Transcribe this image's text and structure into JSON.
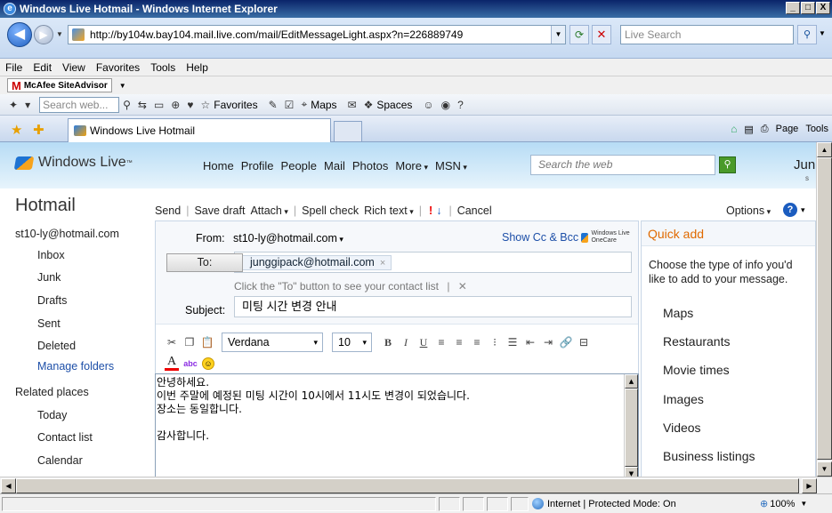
{
  "window": {
    "title": "Windows Live Hotmail - Windows Internet Explorer",
    "min": "_",
    "max": "□",
    "close": "X"
  },
  "address": {
    "url": "http://by104w.bay104.mail.live.com/mail/EditMessageLight.aspx?n=226889749",
    "search_placeholder": "Live Search"
  },
  "menu": [
    "File",
    "Edit",
    "View",
    "Favorites",
    "Tools",
    "Help"
  ],
  "mcafee": {
    "label": "McAfee SiteAdvisor"
  },
  "toolbar": {
    "search_placeholder": "Search web...",
    "favorites": "Favorites",
    "maps": "Maps",
    "spaces": "Spaces"
  },
  "tabs": {
    "active": "Windows Live Hotmail",
    "page_menu": "Page",
    "tools_menu": "Tools"
  },
  "wl": {
    "brand": "Windows Live",
    "brand_tm": "™",
    "nav": [
      "Home",
      "Profile",
      "People",
      "Mail",
      "Photos",
      "More",
      "MSN"
    ],
    "search_placeholder": "Search the web",
    "user": "Jun"
  },
  "hotmail": {
    "title": "Hotmail",
    "commands": {
      "send": "Send",
      "save_draft": "Save draft",
      "attach": "Attach",
      "spell_check": "Spell check",
      "rich_text": "Rich text",
      "cancel": "Cancel"
    },
    "options": "Options"
  },
  "leftnav": {
    "email": "st10-ly@hotmail.com",
    "folders": [
      "Inbox",
      "Junk",
      "Drafts",
      "Sent",
      "Deleted"
    ],
    "manage": "Manage folders",
    "related_title": "Related places",
    "related": [
      "Today",
      "Contact list",
      "Calendar"
    ]
  },
  "compose": {
    "from_label": "From:",
    "from_value": "st10-ly@hotmail.com",
    "show_cc": "Show Cc & Bcc",
    "onecare": "Windows Live OneCare",
    "to_button": "To:",
    "to_recipient": "junggipack@hotmail.com",
    "hint": "Click the \"To\" button to see your contact list",
    "subject_label": "Subject:",
    "subject_value": "미팅 시간 변경 안내",
    "font": "Verdana",
    "size": "10",
    "body": [
      "안녕하세요.",
      "이번 주말에 예정된 미팅 시간이 10시에서 11시도 변경이 되었습니다.",
      "장소는 동일합니다.",
      "",
      "감사합니다."
    ]
  },
  "quickadd": {
    "title": "Quick add",
    "desc": "Choose the type of info you'd like to add to your message.",
    "items": [
      "Maps",
      "Restaurants",
      "Movie times",
      "Images",
      "Videos",
      "Business listings"
    ]
  },
  "status": {
    "zone": "Internet | Protected Mode: On",
    "zoom": "100%"
  }
}
